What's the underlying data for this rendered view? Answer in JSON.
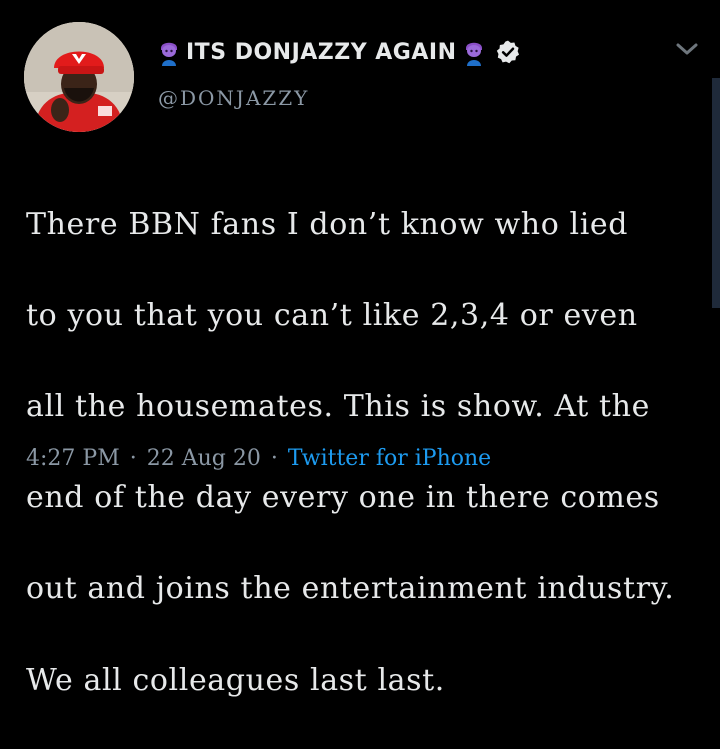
{
  "tweet": {
    "display_name": "ITS DONJAZZY AGAIN",
    "handle": "@DONJAZZY",
    "verified": true,
    "text_lines": [
      "There BBN fans I don’t know who lied",
      "to you that you can’t like 2,3,4 or even",
      "all the housemates. This is show. At the",
      "end of the day every one in there comes",
      "out and joins the entertainment industry.",
      "We all colleagues last last."
    ],
    "time": "4:27 PM",
    "separator": "·",
    "date": "22 Aug 20",
    "source": "Twitter for iPhone"
  },
  "icons": {
    "name_prefix_emoji": "genie-emoji-icon",
    "name_suffix_emoji": "genie-emoji-icon",
    "verified_badge": "verified-badge-icon",
    "more_menu": "chevron-down-icon"
  },
  "colors": {
    "background": "#000000",
    "text": "#e7e9ea",
    "secondary": "#8b98a5",
    "link": "#1d9bf0"
  }
}
